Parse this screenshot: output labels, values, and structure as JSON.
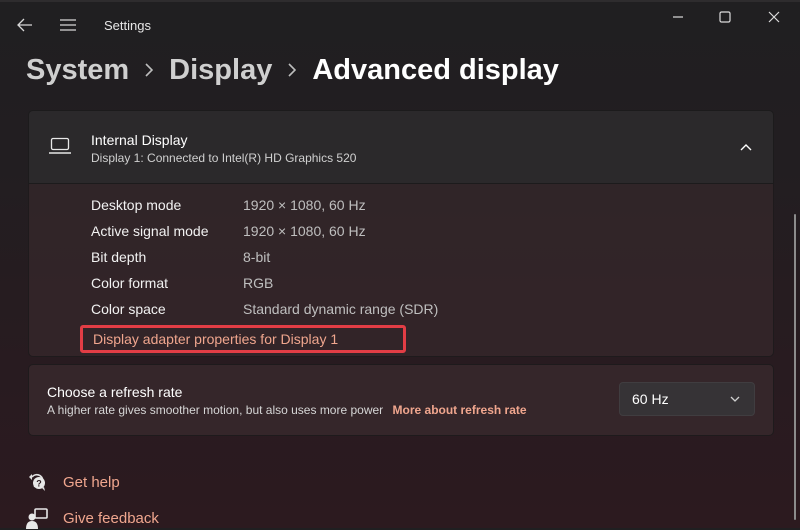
{
  "window": {
    "app_title": "Settings",
    "minimize_icon": "minimize-icon",
    "maximize_icon": "maximize-icon",
    "close_icon": "close-icon"
  },
  "nav": {
    "back_icon": "back-arrow-icon",
    "menu_icon": "hamburger-menu-icon"
  },
  "breadcrumb": {
    "items": [
      "System",
      "Display",
      "Advanced display"
    ],
    "separator_icon": "chevron-right-icon"
  },
  "display_card": {
    "icon": "laptop-icon",
    "title": "Internal Display",
    "subtitle": "Display 1: Connected to Intel(R) HD Graphics 520",
    "expanded": true,
    "collapse_icon": "chevron-up-icon",
    "properties": [
      {
        "label": "Desktop mode",
        "value": "1920 × 1080, 60 Hz"
      },
      {
        "label": "Active signal mode",
        "value": "1920 × 1080, 60 Hz"
      },
      {
        "label": "Bit depth",
        "value": "8-bit"
      },
      {
        "label": "Color format",
        "value": "RGB"
      },
      {
        "label": "Color space",
        "value": "Standard dynamic range (SDR)"
      }
    ],
    "adapter_link": "Display adapter properties for Display 1",
    "highlight_color": "#e23d45"
  },
  "refresh_card": {
    "title": "Choose a refresh rate",
    "description": "A higher rate gives smoother motion, but also uses more power",
    "link": "More about refresh rate",
    "selected": "60 Hz",
    "dropdown_icon": "chevron-down-icon"
  },
  "footer": {
    "items": [
      {
        "label": "Get help",
        "icon": "help-icon"
      },
      {
        "label": "Give feedback",
        "icon": "feedback-icon"
      }
    ]
  },
  "colors": {
    "accent_link": "#f0a68e",
    "highlight_box": "#e23d45"
  }
}
